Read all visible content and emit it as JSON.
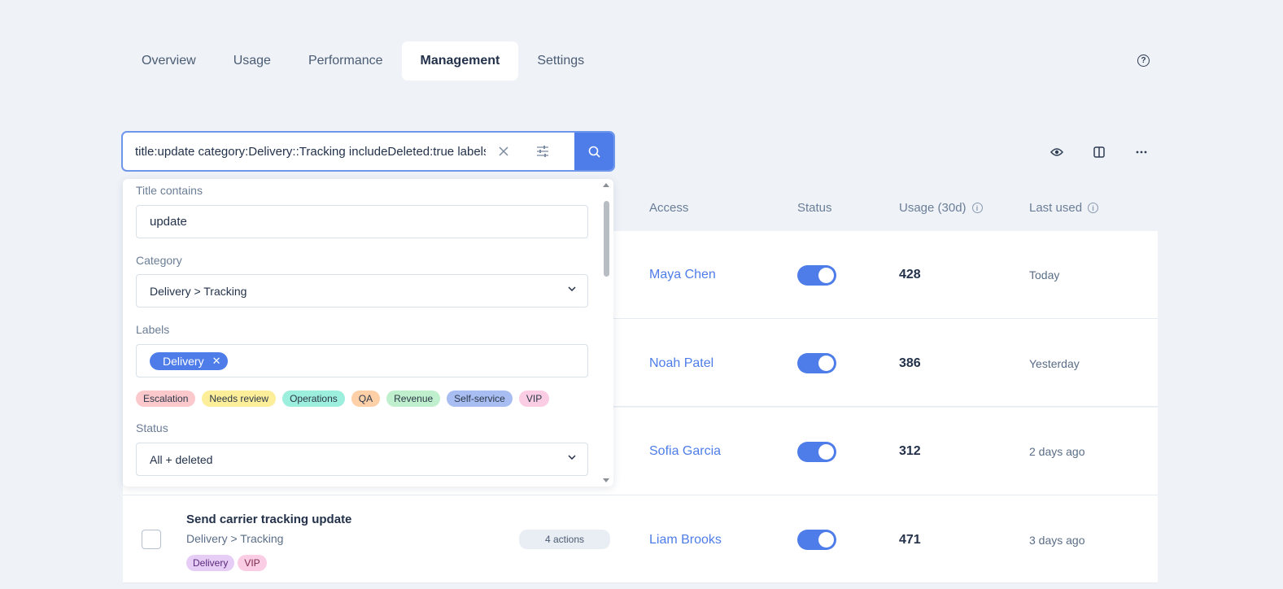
{
  "tabs": [
    {
      "label": "Overview"
    },
    {
      "label": "Usage"
    },
    {
      "label": "Performance"
    },
    {
      "label": "Management"
    },
    {
      "label": "Settings"
    }
  ],
  "active_tab": "Management",
  "search": {
    "value": "title:update category:Delivery::Tracking includeDeleted:true labels:Delivery"
  },
  "table": {
    "headers": {
      "access": "Access",
      "status": "Status",
      "usage": "Usage (30d)",
      "last_used": "Last used"
    },
    "rows": [
      {
        "access": "Maya Chen",
        "status_on": true,
        "usage": "428",
        "last_used": "Today"
      },
      {
        "access": "Noah Patel",
        "status_on": true,
        "usage": "386",
        "last_used": "Yesterday"
      },
      {
        "access": "Sofia Garcia",
        "status_on": true,
        "usage": "312",
        "last_used": "2 days ago"
      },
      {
        "title": "Send carrier tracking update",
        "category": "Delivery > Tracking",
        "labels": [
          "Delivery",
          "VIP"
        ],
        "actions": "4 actions",
        "access": "Liam Brooks",
        "status_on": true,
        "usage": "471",
        "last_used": "3 days ago"
      }
    ]
  },
  "filter_panel": {
    "title_label": "Title contains",
    "title_value": "update",
    "category_label": "Category",
    "category_value": "Delivery > Tracking",
    "labels_label": "Labels",
    "selected_labels": [
      "Delivery"
    ],
    "label_options": [
      {
        "name": "Escalation",
        "color": "#fbc9cc"
      },
      {
        "name": "Needs review",
        "color": "#fdef9a"
      },
      {
        "name": "Operations",
        "color": "#9ceedd"
      },
      {
        "name": "QA",
        "color": "#fdd0a7"
      },
      {
        "name": "Revenue",
        "color": "#bfefcd"
      },
      {
        "name": "Self-service",
        "color": "#a8bdf1"
      },
      {
        "name": "VIP",
        "color": "#fbcde4"
      }
    ],
    "status_label": "Status",
    "status_value": "All + deleted"
  },
  "colors": {
    "accent": "#4e7de9",
    "background": "#eff3f8"
  }
}
